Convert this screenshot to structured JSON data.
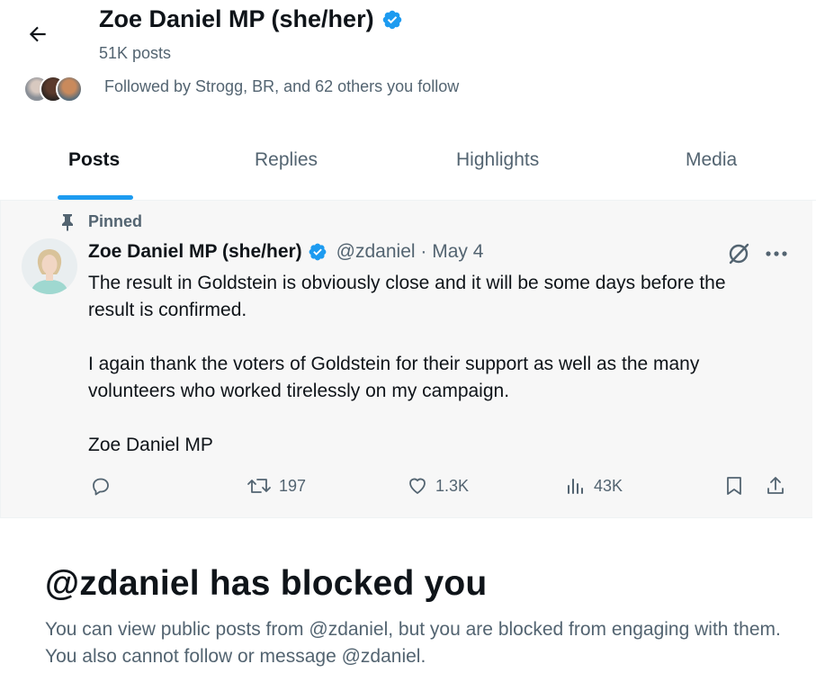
{
  "header": {
    "back_icon": "arrow-left-icon",
    "name": "Zoe Daniel MP (she/her)",
    "verified_icon": "verified-badge-icon",
    "posts_count": "51K posts",
    "followed_by": "Followed by Strogg, BR, and 62 others you follow"
  },
  "tabs": [
    {
      "label": "Posts",
      "active": true
    },
    {
      "label": "Replies",
      "active": false
    },
    {
      "label": "Highlights",
      "active": false
    },
    {
      "label": "Media",
      "active": false
    }
  ],
  "tweet": {
    "pinned_label": "Pinned",
    "author_name": "Zoe Daniel MP (she/her)",
    "handle_date": "@zdaniel · May 4",
    "paragraphs": [
      "The result in Goldstein is obviously close and it will be some days before the result is confirmed.",
      "I again thank the voters of Goldstein for their support as well as the many volunteers who worked tirelessly on my campaign.",
      "Zoe Daniel MP"
    ],
    "retweets": "197",
    "likes": "1.3K",
    "views": "43K"
  },
  "blocked": {
    "title": "@zdaniel has blocked you",
    "description": "You can view public posts from @zdaniel, but you are blocked from engaging with them. You also cannot follow or message @zdaniel."
  },
  "colors": {
    "accent": "#1d9bf0",
    "text_primary": "#0f1419",
    "text_secondary": "#536471",
    "tweet_bg": "#f7f7f7"
  }
}
